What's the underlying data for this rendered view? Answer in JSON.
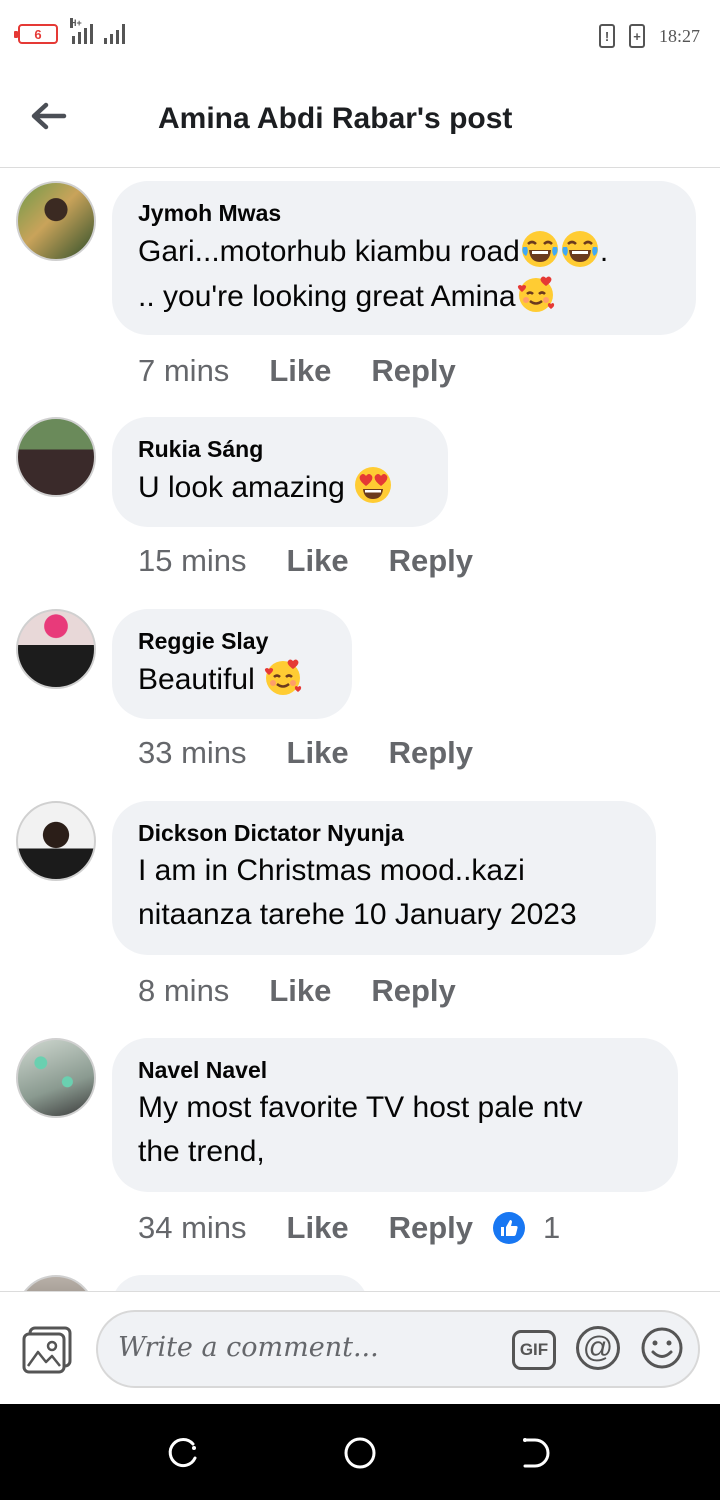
{
  "status_bar": {
    "battery_level": "6",
    "network": "H+",
    "time": "18:27",
    "icons": [
      "battery-low-icon",
      "signal-icon",
      "alert-icon",
      "charging-icon"
    ]
  },
  "header": {
    "title": "Amina Abdi Rabar's post",
    "back_icon": "back-arrow-icon"
  },
  "comments": [
    {
      "name": "Jymoh Mwas",
      "text_lines": [
        "Gari...motorhub kiambu road",
        ".. you're looking great Amina"
      ],
      "emojis": [
        "laugh-cry",
        "laugh-cry",
        "smile-hearts"
      ],
      "time": "7 mins",
      "like": "Like",
      "reply": "Reply"
    },
    {
      "name": "Rukia Sáng",
      "text_lines": [
        "U look amazing "
      ],
      "emojis": [
        "heart-eyes"
      ],
      "time": "15 mins",
      "like": "Like",
      "reply": "Reply"
    },
    {
      "name": "Reggie Slay",
      "text_lines": [
        "Beautiful "
      ],
      "emojis": [
        "smile-hearts"
      ],
      "time": "33 mins",
      "like": "Like",
      "reply": "Reply"
    },
    {
      "name": "Dickson Dictator Nyunja",
      "text_lines": [
        "I am in Christmas mood..kazi",
        "nitaanza tarehe 10 January 2023"
      ],
      "emojis": [],
      "time": "8 mins",
      "like": "Like",
      "reply": "Reply"
    },
    {
      "name": "Navel Navel",
      "text_lines": [
        "My most favorite TV  host pale ntv",
        "the trend,"
      ],
      "emojis": [],
      "time": "34 mins",
      "like": "Like",
      "reply": "Reply",
      "reaction_count": "1",
      "reaction_icon": "like-thumb-icon"
    }
  ],
  "composer": {
    "placeholder": "Write a comment...",
    "gif_label": "GIF",
    "mention_label": "@",
    "icons": [
      "photo-icon",
      "gif-icon",
      "mention-icon",
      "emoji-icon"
    ]
  },
  "nav_bar": {
    "icons": [
      "recent-apps-icon",
      "home-icon",
      "back-icon"
    ]
  },
  "colors": {
    "bubble_bg": "#f0f2f5",
    "secondary_text": "#65676b",
    "like_blue": "#1877f2",
    "battery_red": "#e53935"
  }
}
